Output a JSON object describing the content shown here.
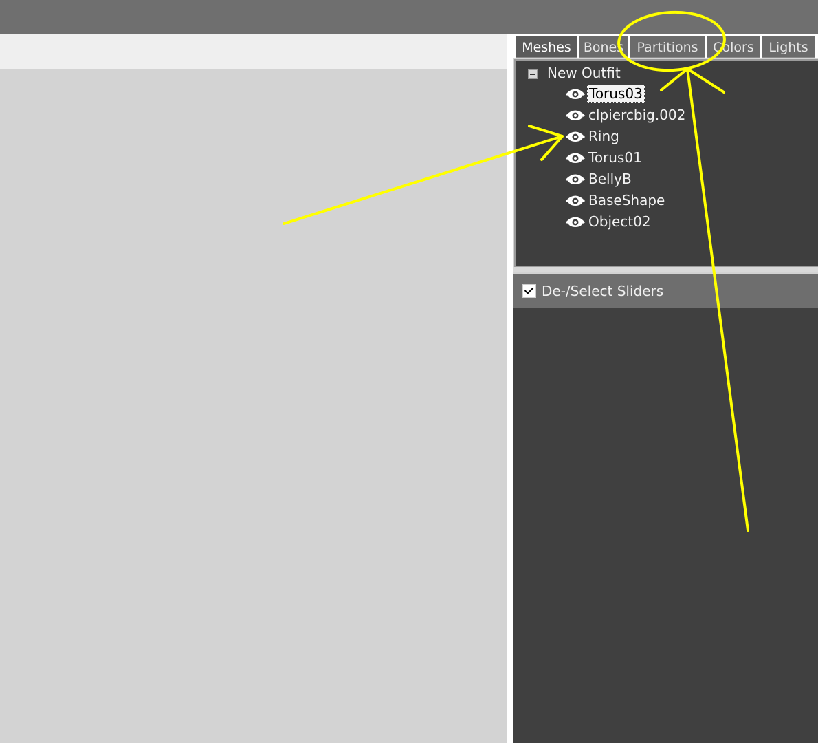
{
  "tabs": [
    "Meshes",
    "Bones",
    "Partitions",
    "Colors",
    "Lights"
  ],
  "tree": {
    "root_label": "New Outfit",
    "items": [
      "Torus03",
      "clpiercbig.002",
      "Ring",
      "Torus01",
      "BellyB",
      "BaseShape",
      "Object02"
    ],
    "selected": "Torus03"
  },
  "sliders": {
    "select_all_label": "De-/Select Sliders",
    "checked": true
  },
  "annotation_color": "#ffff00"
}
